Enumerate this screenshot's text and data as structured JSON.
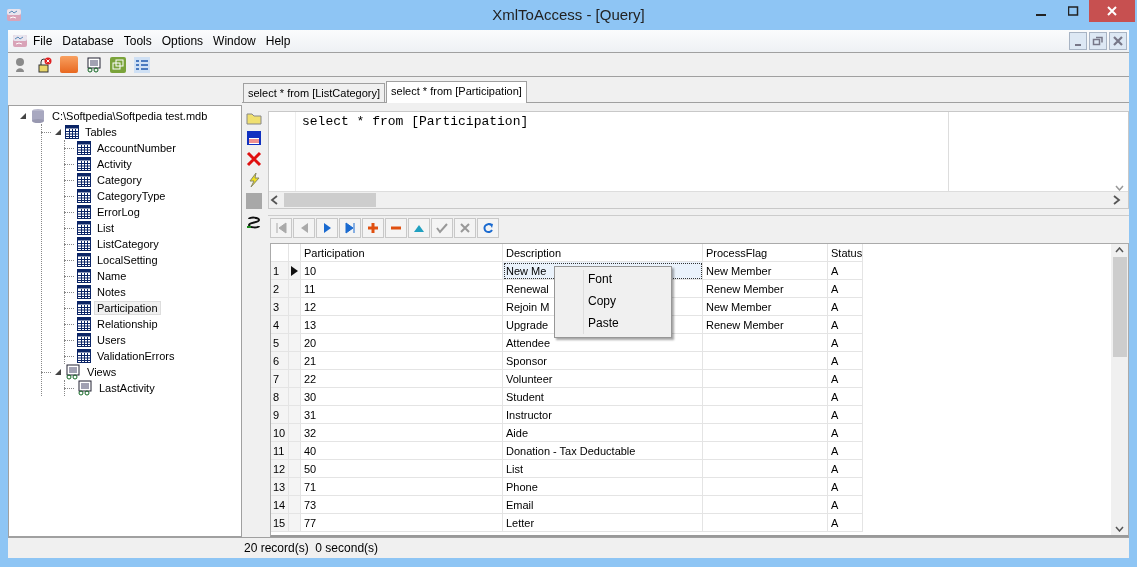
{
  "window": {
    "title": "XmlToAccess - [Query]"
  },
  "menu": [
    "File",
    "Database",
    "Tools",
    "Options",
    "Window",
    "Help"
  ],
  "query_tabs": [
    {
      "label": "select * from [ListCategory]",
      "selected": false
    },
    {
      "label": "select * from [Participation]",
      "selected": true
    }
  ],
  "tree": {
    "label": "C:\\Softpedia\\Softpedia test.mdb",
    "kind": "database",
    "expanded": true,
    "children": [
      {
        "label": "Tables",
        "kind": "folder",
        "expanded": true,
        "children": [
          {
            "label": "AccountNumber",
            "kind": "table",
            "selected": false
          },
          {
            "label": "Activity",
            "kind": "table",
            "selected": false
          },
          {
            "label": "Category",
            "kind": "table",
            "selected": false
          },
          {
            "label": "CategoryType",
            "kind": "table",
            "selected": false
          },
          {
            "label": "ErrorLog",
            "kind": "table",
            "selected": false
          },
          {
            "label": "List",
            "kind": "table",
            "selected": false
          },
          {
            "label": "ListCategory",
            "kind": "table",
            "selected": false
          },
          {
            "label": "LocalSetting",
            "kind": "table",
            "selected": false
          },
          {
            "label": "Name",
            "kind": "table",
            "selected": false
          },
          {
            "label": "Notes",
            "kind": "table",
            "selected": false
          },
          {
            "label": "Participation",
            "kind": "table",
            "selected": true
          },
          {
            "label": "Relationship",
            "kind": "table",
            "selected": false
          },
          {
            "label": "Users",
            "kind": "table",
            "selected": false
          },
          {
            "label": "ValidationErrors",
            "kind": "table",
            "selected": false
          }
        ]
      },
      {
        "label": "Views",
        "kind": "views",
        "expanded": true,
        "children": [
          {
            "label": "LastActivity",
            "kind": "view",
            "selected": false
          }
        ]
      }
    ]
  },
  "editor": {
    "value": "select * from [Participation]"
  },
  "grid": {
    "columns": [
      "Participation",
      "Description",
      "ProcessFlag",
      "Status"
    ],
    "rows": [
      {
        "number": "1",
        "current": true,
        "participation": "10",
        "description": "New Me",
        "process_flag": "New Member",
        "status": "A"
      },
      {
        "number": "2",
        "current": false,
        "participation": "11",
        "description": "Renewal",
        "process_flag": "Renew Member",
        "status": "A"
      },
      {
        "number": "3",
        "current": false,
        "participation": "12",
        "description": "Rejoin M",
        "process_flag": "New Member",
        "status": "A"
      },
      {
        "number": "4",
        "current": false,
        "participation": "13",
        "description": "Upgrade",
        "process_flag": "Renew Member",
        "status": "A"
      },
      {
        "number": "5",
        "current": false,
        "participation": "20",
        "description": "Attendee",
        "status": "A"
      },
      {
        "number": "6",
        "current": false,
        "participation": "21",
        "description": "Sponsor",
        "status": "A"
      },
      {
        "number": "7",
        "current": false,
        "participation": "22",
        "description": "Volunteer",
        "status": "A"
      },
      {
        "number": "8",
        "current": false,
        "participation": "30",
        "description": "Student",
        "status": "A"
      },
      {
        "number": "9",
        "current": false,
        "participation": "31",
        "description": "Instructor",
        "status": "A"
      },
      {
        "number": "10",
        "current": false,
        "participation": "32",
        "description": "Aide",
        "status": "A"
      },
      {
        "number": "11",
        "current": false,
        "participation": "40",
        "description": "Donation - Tax Deductable",
        "status": "A"
      },
      {
        "number": "12",
        "current": false,
        "participation": "50",
        "description": "List",
        "status": "A"
      },
      {
        "number": "13",
        "current": false,
        "participation": "71",
        "description": "Phone",
        "status": "A"
      },
      {
        "number": "14",
        "current": false,
        "participation": "73",
        "description": "Email",
        "status": "A"
      },
      {
        "number": "15",
        "current": false,
        "participation": "77",
        "description": "Letter",
        "status": "A"
      }
    ]
  },
  "context_menu": {
    "items": [
      "Font",
      "Copy",
      "Paste"
    ]
  },
  "status_bar": "20 record(s)  0 second(s)"
}
